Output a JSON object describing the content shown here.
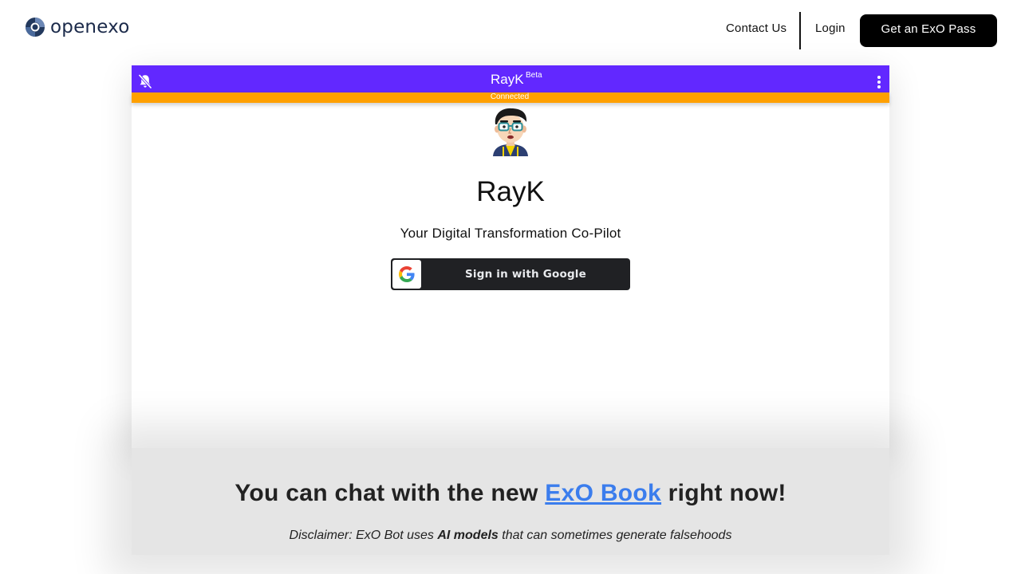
{
  "nav": {
    "logo_text": "openexo",
    "contact_label": "Contact Us",
    "login_label": "Login",
    "cta_label": "Get an ExO Pass"
  },
  "chat": {
    "title": "RayK",
    "beta_label": "Beta",
    "status": "Connected",
    "bot_name": "RayK",
    "tagline": "Your Digital Transformation Co-Pilot",
    "google_button_label": "Sign in with Google",
    "header_color": "#6228ff",
    "status_color": "#ffa000"
  },
  "promo": {
    "title_prefix": "You can chat with the new ",
    "title_link": "ExO Book",
    "title_suffix": " right now!",
    "link_color": "#3b7ded"
  },
  "disclaimer": {
    "prefix": "Disclaimer: ExO Bot uses ",
    "emphasis": "AI models",
    "suffix": " that can sometimes generate falsehoods"
  },
  "icons": {
    "notification": "bell-off-icon",
    "menu": "kebab-menu-icon",
    "google": "google-g-icon",
    "logo": "openexo-logo-icon"
  }
}
